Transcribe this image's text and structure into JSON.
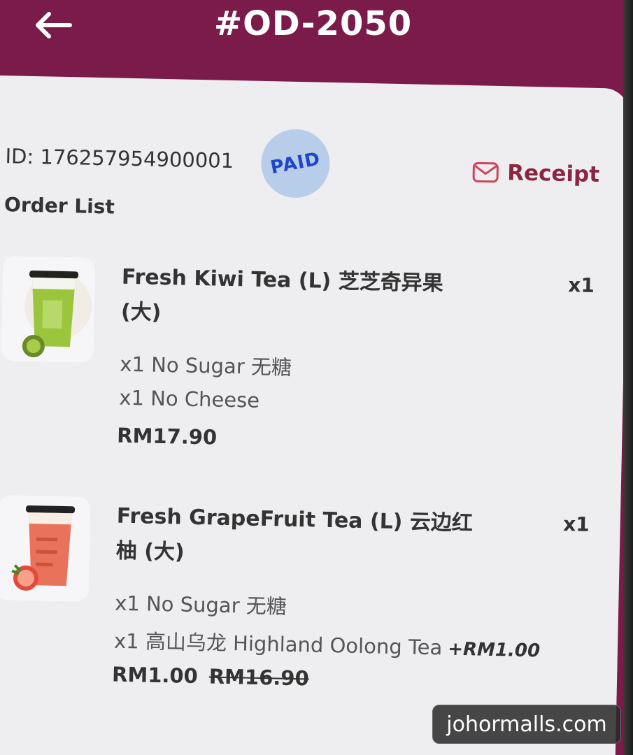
{
  "header": {
    "title": "#OD-2050",
    "back_icon": "arrow-left-icon"
  },
  "order": {
    "id_text": "ID: 176257954900001",
    "status_badge": "PAID",
    "receipt_label": "Receipt",
    "receipt_icon": "envelope-icon",
    "section_title": "Order List"
  },
  "items": [
    {
      "name": "Fresh Kiwi Tea (L) 芝芝奇异果 (大)",
      "qty": "x1",
      "options": [
        "x1 No Sugar 无糖",
        "x1 No Cheese"
      ],
      "price": "RM17.90",
      "thumb_color": "#8fbf3a"
    },
    {
      "name": "Fresh GrapeFruit Tea (L) 云边红柚 (大)",
      "qty": "x1",
      "options": [
        "x1 No Sugar 无糖",
        "x1 高山乌龙 Highland Oolong Tea"
      ],
      "option_extra": "+RM1.00",
      "price": "RM1.00",
      "original_price": "RM16.90",
      "thumb_color": "#e8735a"
    }
  ],
  "watermark": "johormalls.com",
  "colors": {
    "header_bg": "#7a1b4a",
    "card_bg": "#eeeef0",
    "paid_badge_bg": "#b7cde9",
    "paid_text": "#1f46c9",
    "receipt_accent": "#8c2540"
  }
}
